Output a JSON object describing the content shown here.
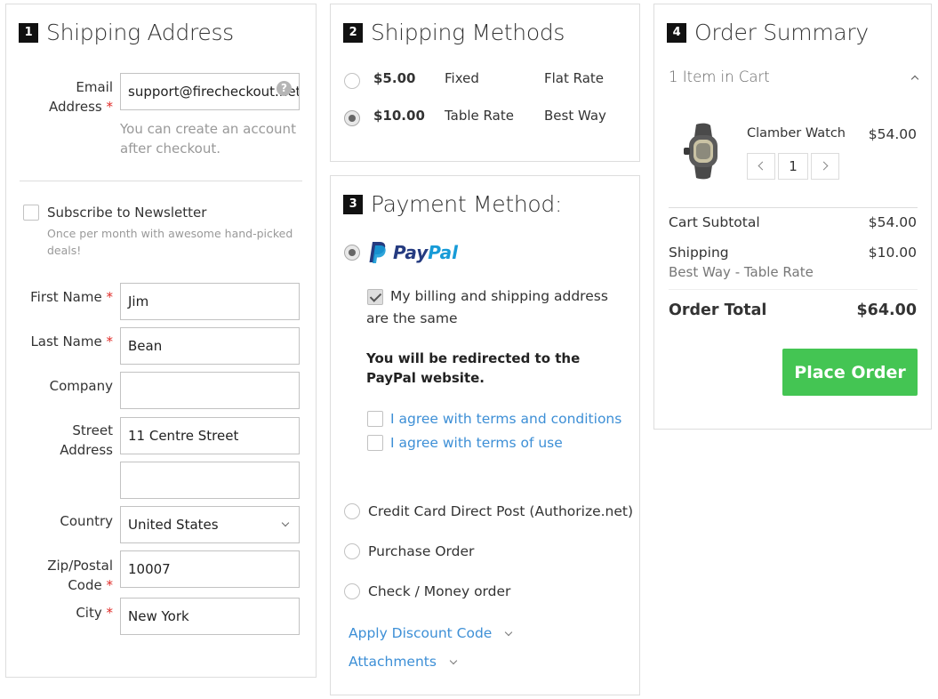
{
  "shipping": {
    "step": "1",
    "title": "Shipping Address",
    "email_label_1": "Email",
    "email_label_2": "Address",
    "req": "*",
    "email_value": "support@firecheckout.net",
    "email_hint": "You can create an account after checkout.",
    "newsletter_label": "Subscribe to Newsletter",
    "newsletter_hint": "Once per month with awesome hand-picked deals!",
    "first_name_label": "First Name",
    "first_name_value": "Jim",
    "last_name_label": "Last Name",
    "last_name_value": "Bean",
    "company_label": "Company",
    "company_value": "",
    "street_label_1": "Street",
    "street_label_2": "Address",
    "street_value_1": "11 Centre Street",
    "street_value_2": "",
    "country_label": "Country",
    "country_value": "United States",
    "zip_label_1": "Zip/Postal",
    "zip_label_2": "Code",
    "zip_value": "10007",
    "city_label": "City",
    "city_value": "New York"
  },
  "methods": {
    "step": "2",
    "title": "Shipping Methods",
    "rows": [
      {
        "price": "$5.00",
        "method": "Fixed",
        "carrier": "Flat Rate",
        "selected": false
      },
      {
        "price": "$10.00",
        "method": "Table Rate",
        "carrier": "Best Way",
        "selected": true
      }
    ]
  },
  "payment": {
    "step": "3",
    "title": "Payment Method:",
    "paypal_pay": "Pay",
    "paypal_pal": "Pal",
    "same_address": "My billing and shipping address are the same",
    "redirect_note": "You will be redirected to the PayPal website.",
    "agree_terms": "I agree with terms and conditions",
    "agree_use": "I agree with terms of use",
    "options": [
      "Credit Card Direct Post (Authorize.net)",
      "Purchase Order",
      "Check / Money order"
    ],
    "discount_link": "Apply Discount Code",
    "attachments_link": "Attachments"
  },
  "summary": {
    "step": "4",
    "title": "Order Summary",
    "items_in_cart": "1 Item in Cart",
    "product_name": "Clamber Watch",
    "product_price": "$54.00",
    "qty": "1",
    "subtotal_label": "Cart Subtotal",
    "subtotal_value": "$54.00",
    "shipping_label": "Shipping",
    "shipping_method": "Best Way - Table Rate",
    "shipping_value": "$10.00",
    "total_label": "Order Total",
    "total_value": "$64.00",
    "place_order": "Place Order"
  },
  "colors": {
    "accent_green": "#44c553",
    "link_blue": "#3d8fd6",
    "required_red": "#e02b27",
    "paypal_dark": "#253b80",
    "paypal_light": "#179bd7"
  }
}
